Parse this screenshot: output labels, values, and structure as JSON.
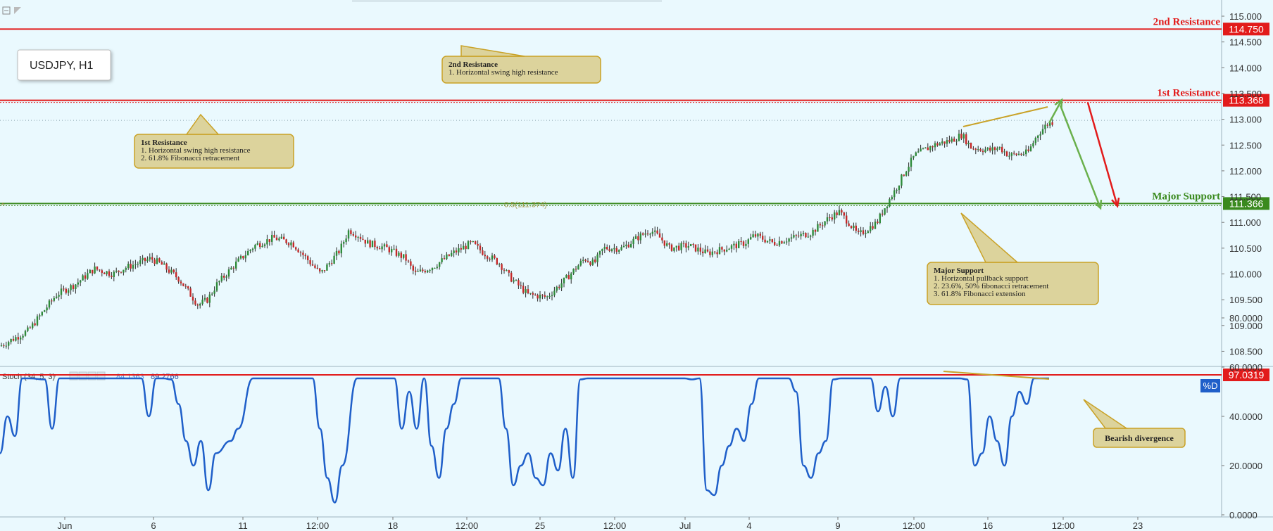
{
  "symbol_label": "USDJPY, H1",
  "colors": {
    "background": "#eaf9fe",
    "bull_candle": "#2e8b3a",
    "bear_candle": "#c62828",
    "resistance": "#e21b1b",
    "support": "#3a8a1e",
    "stoch_line": "#1f5fc9",
    "note_fill": "#dcd39c",
    "note_border": "#c9a227",
    "axis_text": "#333333"
  },
  "chart_data": [
    {
      "type": "candlestick",
      "title": "USDJPY, H1",
      "y_axis": {
        "ticks": [
          "115.000",
          "114.500",
          "114.000",
          "113.500",
          "113.000",
          "112.500",
          "112.000",
          "111.500",
          "111.000",
          "110.500",
          "110.000",
          "109.500",
          "109.000",
          "108.500"
        ],
        "ylim": [
          108.3,
          115.2
        ],
        "side": "right"
      },
      "x_axis": {
        "ticks": [
          "Jun",
          "6",
          "11",
          "12:00",
          "18",
          "12:00",
          "25",
          "12:00",
          "Jul",
          "4",
          "9",
          "12:00",
          "16",
          "12:00",
          "23"
        ]
      },
      "price_path": [
        [
          0,
          108.6
        ],
        [
          3,
          108.9
        ],
        [
          6,
          109.6
        ],
        [
          8,
          109.8
        ],
        [
          10,
          110.1
        ],
        [
          12,
          110.0
        ],
        [
          13,
          110.1
        ],
        [
          16,
          110.3
        ],
        [
          17,
          110.2
        ],
        [
          19,
          109.9
        ],
        [
          21,
          109.4
        ],
        [
          22,
          109.5
        ],
        [
          23,
          109.8
        ],
        [
          25,
          110.2
        ],
        [
          27,
          110.55
        ],
        [
          29,
          110.7
        ],
        [
          31,
          110.6
        ],
        [
          33,
          110.2
        ],
        [
          34,
          110.0
        ],
        [
          36,
          110.45
        ],
        [
          37,
          110.85
        ],
        [
          38,
          110.75
        ],
        [
          39,
          110.6
        ],
        [
          41,
          110.5
        ],
        [
          43,
          110.3
        ],
        [
          44,
          110.0
        ],
        [
          46,
          110.15
        ],
        [
          48,
          110.4
        ],
        [
          50,
          110.6
        ],
        [
          51,
          110.45
        ],
        [
          53,
          110.2
        ],
        [
          54,
          109.95
        ],
        [
          56,
          109.6
        ],
        [
          58,
          109.55
        ],
        [
          60,
          109.9
        ],
        [
          62,
          110.3
        ],
        [
          63,
          110.2
        ],
        [
          64,
          110.5
        ],
        [
          66,
          110.5
        ],
        [
          68,
          110.75
        ],
        [
          69,
          110.85
        ],
        [
          70,
          110.7
        ],
        [
          71,
          110.5
        ],
        [
          73,
          110.55
        ],
        [
          75,
          110.4
        ],
        [
          77,
          110.5
        ],
        [
          79,
          110.6
        ],
        [
          80,
          110.75
        ],
        [
          82,
          110.6
        ],
        [
          84,
          110.7
        ],
        [
          86,
          110.8
        ],
        [
          88,
          111.1
        ],
        [
          89,
          111.2
        ],
        [
          90,
          111.0
        ],
        [
          91,
          110.75
        ],
        [
          93,
          111.0
        ],
        [
          94,
          111.35
        ],
        [
          95,
          111.65
        ],
        [
          96,
          112.0
        ],
        [
          97,
          112.3
        ],
        [
          99,
          112.5
        ],
        [
          101,
          112.6
        ],
        [
          102,
          112.7
        ],
        [
          103,
          112.45
        ],
        [
          105,
          112.4
        ],
        [
          106,
          112.45
        ],
        [
          107,
          112.3
        ],
        [
          109,
          112.35
        ],
        [
          110,
          112.7
        ],
        [
          111,
          112.9
        ],
        [
          112,
          112.98
        ]
      ],
      "horizontal_levels": [
        {
          "name": "2nd Resistance",
          "value": 114.75,
          "value_label": "114.750"
        },
        {
          "name": "1st Resistance",
          "value": 113.368,
          "value_label": "113.368"
        },
        {
          "name": "Major Support",
          "value": 111.366,
          "value_label": "111.366"
        }
      ],
      "fib_label": "0.5(111.374)",
      "annotations": [
        {
          "lines": [
            "2nd Resistance",
            "1. Horizontal swing high resistance"
          ]
        },
        {
          "lines": [
            "1st Resistance",
            "1. Horizontal swing high resistance",
            "2. 61.8% Fibonacci retracement"
          ]
        },
        {
          "lines": [
            "Major Support",
            "1. Horizontal pullback support",
            "2. 23.6%, 50% fibonacci retracement",
            "3. 61.8% Fibonacci extension"
          ]
        }
      ]
    },
    {
      "type": "line",
      "title": "Stoch (34, 5, 3)",
      "series": [
        {
          "name": "%D"
        }
      ],
      "legend_values": [
        "84.1363",
        "89.2766"
      ],
      "y_axis": {
        "ticks": [
          "80.0000",
          "60.0000",
          "40.0000",
          "20.0000",
          "0.0000"
        ],
        "ylim": [
          0,
          100
        ]
      },
      "level": {
        "value": 97.0319,
        "value_label": "97.0319"
      },
      "stoch_path": [
        [
          0,
          25
        ],
        [
          1,
          40
        ],
        [
          2,
          32
        ],
        [
          3,
          65
        ],
        [
          4,
          85
        ],
        [
          6,
          55
        ],
        [
          7,
          35
        ],
        [
          8,
          65
        ],
        [
          9,
          85
        ],
        [
          10,
          75
        ],
        [
          11,
          93
        ],
        [
          12,
          90
        ],
        [
          13,
          75
        ],
        [
          14,
          92
        ],
        [
          15,
          80
        ],
        [
          16,
          70
        ],
        [
          17,
          93
        ],
        [
          18,
          90
        ],
        [
          19,
          60
        ],
        [
          20,
          40
        ],
        [
          21,
          85
        ],
        [
          22,
          93
        ],
        [
          23,
          55
        ],
        [
          24,
          45
        ],
        [
          25,
          30
        ],
        [
          26,
          20
        ],
        [
          27,
          30
        ],
        [
          28,
          10
        ],
        [
          29,
          25
        ],
        [
          31,
          30
        ],
        [
          32,
          35
        ],
        [
          34,
          88
        ],
        [
          35,
          92
        ],
        [
          36,
          80
        ],
        [
          37,
          68
        ],
        [
          38,
          85
        ],
        [
          39,
          92
        ],
        [
          40,
          85
        ],
        [
          42,
          60
        ],
        [
          43,
          35
        ],
        [
          44,
          15
        ],
        [
          45,
          5
        ],
        [
          46,
          20
        ],
        [
          48,
          80
        ],
        [
          49,
          90
        ],
        [
          50,
          70
        ],
        [
          51,
          60
        ],
        [
          52,
          88
        ],
        [
          53,
          78
        ],
        [
          54,
          35
        ],
        [
          55,
          50
        ],
        [
          56,
          35
        ],
        [
          57,
          75
        ],
        [
          58,
          28
        ],
        [
          59,
          15
        ],
        [
          60,
          35
        ],
        [
          61,
          45
        ],
        [
          62,
          60
        ],
        [
          63,
          75
        ],
        [
          64,
          92
        ],
        [
          65,
          94
        ],
        [
          66,
          88
        ],
        [
          67,
          65
        ],
        [
          68,
          35
        ],
        [
          69,
          12
        ],
        [
          70,
          20
        ],
        [
          71,
          25
        ],
        [
          72,
          15
        ],
        [
          73,
          12
        ],
        [
          74,
          25
        ],
        [
          75,
          18
        ],
        [
          76,
          35
        ],
        [
          77,
          15
        ],
        [
          78,
          55
        ],
        [
          79,
          88
        ],
        [
          80,
          75
        ],
        [
          81,
          65
        ],
        [
          82,
          90
        ],
        [
          83,
          80
        ],
        [
          84,
          88
        ],
        [
          85,
          70
        ],
        [
          86,
          65
        ],
        [
          87,
          80
        ],
        [
          88,
          62
        ],
        [
          89,
          65
        ],
        [
          90,
          88
        ],
        [
          91,
          80
        ],
        [
          92,
          70
        ],
        [
          93,
          55
        ],
        [
          94,
          68
        ],
        [
          95,
          10
        ],
        [
          96,
          8
        ],
        [
          97,
          20
        ],
        [
          98,
          28
        ],
        [
          99,
          35
        ],
        [
          100,
          30
        ],
        [
          101,
          45
        ],
        [
          102,
          70
        ],
        [
          103,
          90
        ],
        [
          104,
          82
        ],
        [
          105,
          85
        ],
        [
          106,
          70
        ],
        [
          107,
          50
        ],
        [
          108,
          20
        ],
        [
          109,
          15
        ],
        [
          110,
          25
        ],
        [
          111,
          30
        ],
        [
          112,
          55
        ],
        [
          113,
          78
        ],
        [
          114,
          96
        ],
        [
          115,
          90
        ],
        [
          116,
          88
        ],
        [
          117,
          60
        ],
        [
          118,
          42
        ],
        [
          119,
          52
        ],
        [
          120,
          40
        ],
        [
          121,
          80
        ],
        [
          122,
          92
        ],
        [
          123,
          95
        ],
        [
          124,
          88
        ],
        [
          125,
          93
        ],
        [
          126,
          94
        ],
        [
          127,
          85
        ],
        [
          128,
          88
        ],
        [
          129,
          70
        ],
        [
          130,
          55
        ],
        [
          131,
          20
        ],
        [
          132,
          25
        ],
        [
          133,
          40
        ],
        [
          134,
          30
        ],
        [
          135,
          20
        ],
        [
          136,
          40
        ],
        [
          137,
          50
        ],
        [
          138,
          45
        ],
        [
          139,
          90
        ],
        [
          140,
          93
        ],
        [
          141,
          88
        ]
      ],
      "annotation": "Bearish divergence"
    }
  ]
}
